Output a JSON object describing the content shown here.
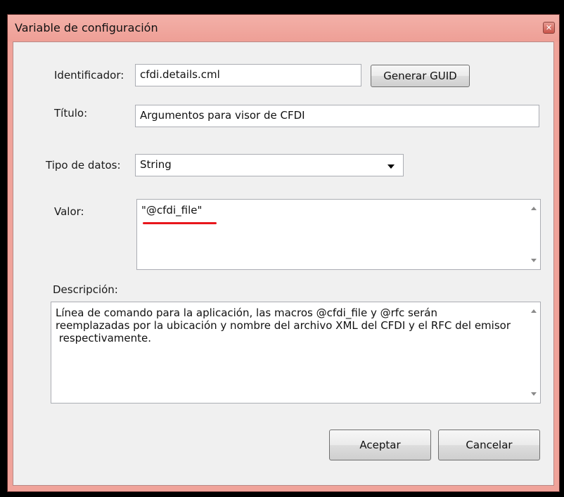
{
  "window": {
    "title": "Variable de configuración",
    "close_icon": "close-icon"
  },
  "form": {
    "identificador_label": "Identificador:",
    "identificador_value": "cfdi.details.cml",
    "generar_guid_label": "Generar GUID",
    "titulo_label": "Título:",
    "titulo_value": "Argumentos para visor de CFDI",
    "tipo_label": "Tipo de datos:",
    "tipo_value": "String",
    "valor_label": "Valor:",
    "valor_value": "\"@cfdi_file\"",
    "descripcion_label": "Descripción:",
    "descripcion_value": "Línea de comando para la aplicación, las macros @cfdi_file y @rfc serán\nreemplazadas por la ubicación y nombre del archivo XML del CFDI y el RFC del emisor\n respectivamente."
  },
  "buttons": {
    "accept_label": "Aceptar",
    "cancel_label": "Cancelar"
  },
  "colors": {
    "title_bar": "#ee9f96",
    "annotation_underline": "#e8161c"
  }
}
